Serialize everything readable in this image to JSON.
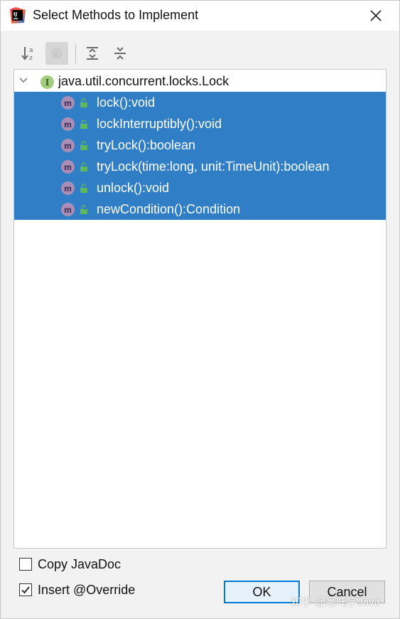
{
  "window": {
    "title": "Select Methods to Implement",
    "app_icon": "intellij-idea-icon",
    "close_icon": "close-icon"
  },
  "toolbar": {
    "buttons": [
      {
        "icon": "sort-alphabetically-icon",
        "pressed": false
      },
      {
        "icon": "show-classes-icon",
        "pressed": true
      },
      {
        "icon": "expand-all-icon",
        "pressed": false
      },
      {
        "icon": "collapse-all-icon",
        "pressed": false
      }
    ]
  },
  "tree": {
    "root": {
      "label": "java.util.concurrent.locks.Lock",
      "icon": "interface-icon",
      "icon_letter": "I",
      "expanded": true
    },
    "methods": [
      {
        "label": "lock():void",
        "icon_letter": "m",
        "selected": true
      },
      {
        "label": "lockInterruptibly():void",
        "icon_letter": "m",
        "selected": true
      },
      {
        "label": "tryLock():boolean",
        "icon_letter": "m",
        "selected": true
      },
      {
        "label": "tryLock(time:long, unit:TimeUnit):boolean",
        "icon_letter": "m",
        "selected": true
      },
      {
        "label": "unlock():void",
        "icon_letter": "m",
        "selected": true
      },
      {
        "label": "newCondition():Condition",
        "icon_letter": "m",
        "selected": true
      }
    ]
  },
  "options": {
    "copy_javadoc": {
      "label": "Copy JavaDoc",
      "checked": false
    },
    "insert_override": {
      "label": "Insert @Override",
      "checked": true
    }
  },
  "buttons": {
    "ok": "OK",
    "cancel": "Cancel"
  },
  "watermark": "知乎 @哪吒学Java",
  "colors": {
    "selection": "#2f7ec6",
    "interface_icon": "#a3cd7e",
    "method_icon": "#a98fb8",
    "public_lock": "#5fb85f",
    "ok_border": "#0078d7"
  }
}
